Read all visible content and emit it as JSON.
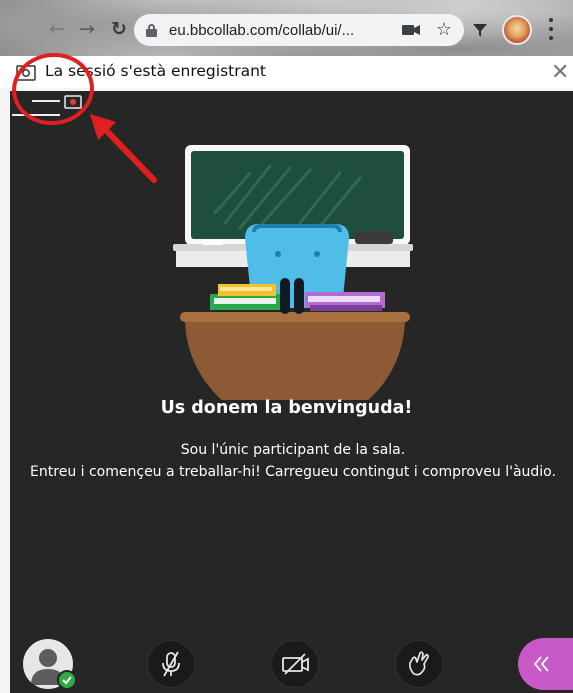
{
  "browser": {
    "url": "eu.bbcollab.com/collab/ui/..."
  },
  "notice": {
    "text": "La sessió s'està enregistrant"
  },
  "welcome": {
    "title": "Us donem la benvinguda!",
    "line1": "Sou l'únic participant de la sala.",
    "line2": "Entreu i començeu a treballar-hi! Carregueu contingut i comproveu l'àudio."
  },
  "icons": {
    "back": "arrow-left-icon",
    "forward": "arrow-right-icon",
    "reload": "reload-icon",
    "lock": "lock-icon",
    "camera": "camera-blocked-icon",
    "star": "star-icon",
    "record": "recording-icon",
    "close": "close-icon",
    "mic": "microphone-muted-icon",
    "video": "camera-off-icon",
    "hand": "raise-hand-icon",
    "panel": "double-chevron-left-icon"
  },
  "colors": {
    "session_bg": "#262626",
    "accent_panel": "#c85ac8",
    "status_ok": "#2eaa42",
    "annotation": "#e02020"
  }
}
